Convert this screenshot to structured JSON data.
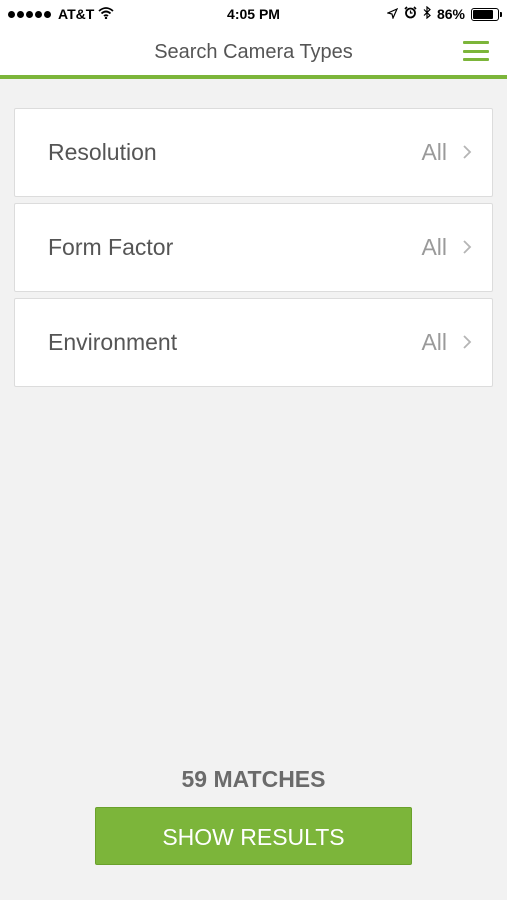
{
  "status_bar": {
    "carrier": "AT&T",
    "time": "4:05 PM",
    "battery_percent": "86%",
    "battery_level": 0.86,
    "icons": [
      "signal-dots-icon",
      "wifi-icon",
      "location-icon",
      "alarm-icon",
      "bluetooth-icon",
      "battery-icon"
    ]
  },
  "nav": {
    "title": "Search Camera Types",
    "menu_icon": "hamburger-menu-icon"
  },
  "filters": [
    {
      "label": "Resolution",
      "value": "All"
    },
    {
      "label": "Form Factor",
      "value": "All"
    },
    {
      "label": "Environment",
      "value": "All"
    }
  ],
  "footer": {
    "matches": "59 MATCHES",
    "button_label": "SHOW RESULTS"
  },
  "colors": {
    "accent": "#7cb53a",
    "background": "#f2f2f2",
    "label": "#555555",
    "value": "#9a9a9a"
  }
}
